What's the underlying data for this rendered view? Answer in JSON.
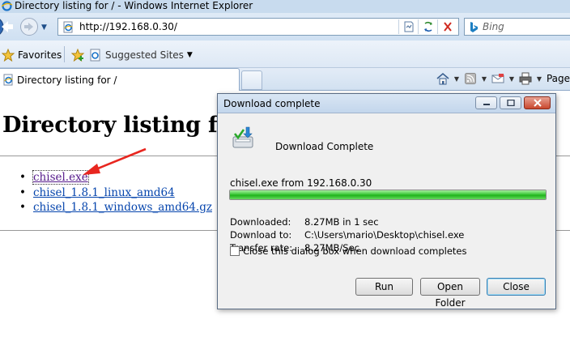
{
  "window": {
    "title": "Directory listing for / - Windows Internet Explorer"
  },
  "address": {
    "url": "http://192.168.0.30/"
  },
  "search": {
    "placeholder": "Bing"
  },
  "favorites": {
    "label": "Favorites",
    "suggested": "Suggested Sites"
  },
  "tab": {
    "label": "Directory listing for /"
  },
  "command_bar": {
    "page_label": "Page"
  },
  "page": {
    "heading": "Directory listing for /",
    "files": [
      "chisel.exe",
      "chisel_1.8.1_linux_amd64",
      "chisel_1.8.1_windows_amd64.gz"
    ]
  },
  "dialog": {
    "title": "Download complete",
    "heading": "Download Complete",
    "source": "chisel.exe from 192.168.0.30",
    "progress": 1.0,
    "details": [
      {
        "key": "Downloaded:",
        "value": "8.27MB in 1 sec"
      },
      {
        "key": "Download to:",
        "value": "C:\\Users\\mario\\Desktop\\chisel.exe"
      },
      {
        "key": "Transfer rate:",
        "value": "8.27MB/Sec"
      }
    ],
    "checkbox_label": "Close this dialog box when download completes",
    "checkbox_checked": false,
    "buttons": {
      "run": "Run",
      "open_folder": "Open Folder",
      "close": "Close"
    }
  },
  "colors": {
    "link": "#0645ad",
    "visited_link": "#551a8b",
    "annotation_arrow": "#e8261f",
    "progress_green": "#1fb21b"
  }
}
